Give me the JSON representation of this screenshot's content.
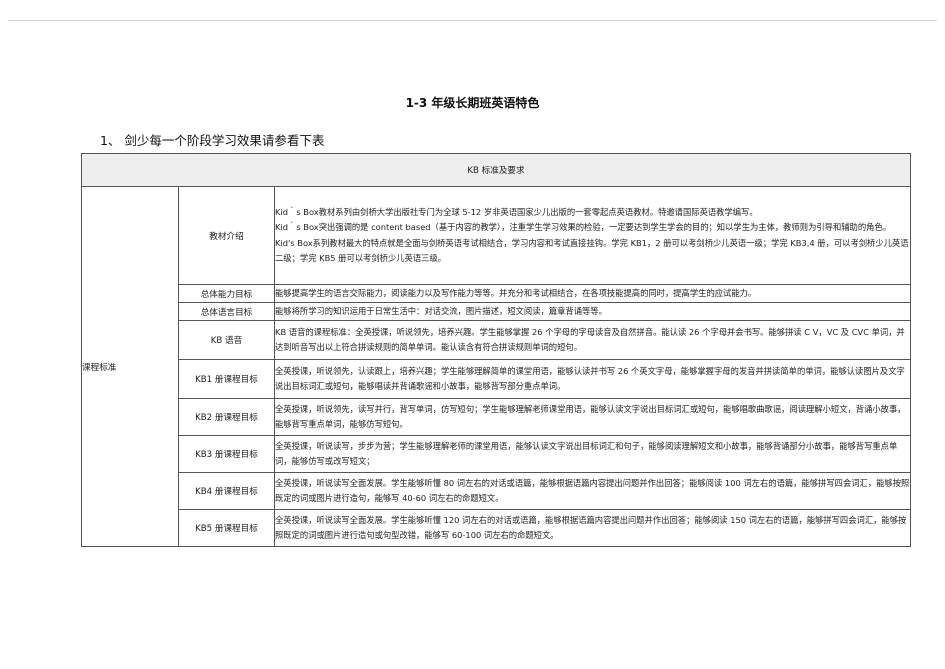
{
  "doc": {
    "title": "1-3 年级长期班英语特色",
    "heading": "1、 剑少每一个阶段学习效果请参看下表"
  },
  "table": {
    "header": "KB 标准及要求",
    "category": "课程标准",
    "rows": [
      {
        "label": "教材介绍",
        "paragraphs": [
          "Kid｀s Box教材系列由剑桥大学出版社专门为全球 5-12 岁非英语国家少儿出版的一套零起点英语教材。特邀请国际英语教学编写。",
          "Kid｀s Box突出强调的是 content based（基于内容的教学），注重学生学习效果的检验，一定要达到学生学会的目的；知以学生为主体，教师则为引导和辅助的角色。",
          "Kid's Box系列教材最大的特点就是全面与剑桥英语考试相结合，学习内容和考试直接挂钩。学完 KB1，2 册可以考剑桥少儿英语一级；学完 KB3,4 册，可以考剑桥少儿英语二级；学完 KB5 册可以考剑桥少儿英语三级。"
        ]
      },
      {
        "label": "总体能力目标",
        "paragraphs": [
          "能够提高学生的语言交际能力，阅读能力以及写作能力等等。并充分和考试相结合，在各项技能提高的同时，提高学生的应试能力。"
        ]
      },
      {
        "label": "总体语言目标",
        "paragraphs": [
          "能够将所学习的知识运用于日常生活中：对话交流，图片描述，短文阅读，篇章背诵等等。"
        ]
      },
      {
        "label": "KB 语音",
        "paragraphs": [
          "KB 语音的课程标准：全英授课，听说领先，培养兴趣。学生能够掌握 26 个字母的字母读音及自然拼音。能认读 26 个字母并会书写。能够拼读 C V，VC 及 CVC 单词，并达到听音写出以上符合拼读规则的简单单词。能认读含有符合拼读规则单词的短句。"
        ]
      },
      {
        "label": "KB1 册课程目标",
        "paragraphs": [
          "全英授课，听说领先，认读跟上，培养兴趣；学生能够理解简单的课堂用语，能够认读并书写 26 个英文字母，能够掌握字母的发音并拼读简单的单词，能够认读图片及文字说出目标词汇或短句，能够唱读并背诵歌谣和小故事，能够背写部分重点单词。"
        ]
      },
      {
        "label": "KB2 册课程目标",
        "paragraphs": [
          "全英授课，听说领先，读写并行，背写单词，仿写短句；学生能够理解老师课堂用语，能够认读文字说出目标词汇或短句，能够唱歌曲歌谣，阅读理解小短文，背诵小故事，能够背写重点单词，能够仿写短句。"
        ]
      },
      {
        "label": "KB3 册课程目标",
        "paragraphs": [
          "全英授课，听说读写，步步为营；学生能够理解老师的课堂用语，能够认读文字说出目标词汇和句子，能够阅读理解短文和小故事，能够背诵部分小故事，能够背写重点单词，能够仿写或改写短文；"
        ]
      },
      {
        "label": "KB4 册课程目标",
        "paragraphs": [
          "全英授课，听说读写全面发展。学生能够听懂 80 词左右的对话或语篇，能够根据语篇内容提出问题并作出回答；能够阅读 100 词左右的语篇，能够拼写四会词汇，能够按照既定的词或图片进行造句，能够写 40-60 词左右的命题短文。"
        ]
      },
      {
        "label": "KB5 册课程目标",
        "paragraphs": [
          "全英授课，听说读写全面发展。学生能够听懂 120 词左右的对话或语篇，能够根据语篇内容提出问题并作出回答；能够阅读 150 词左右的语篇，能够拼写四会词汇，能够按照既定的词或图片进行造句或句型改错，能够写 60-100 词左右的命题短文。"
        ]
      }
    ]
  }
}
